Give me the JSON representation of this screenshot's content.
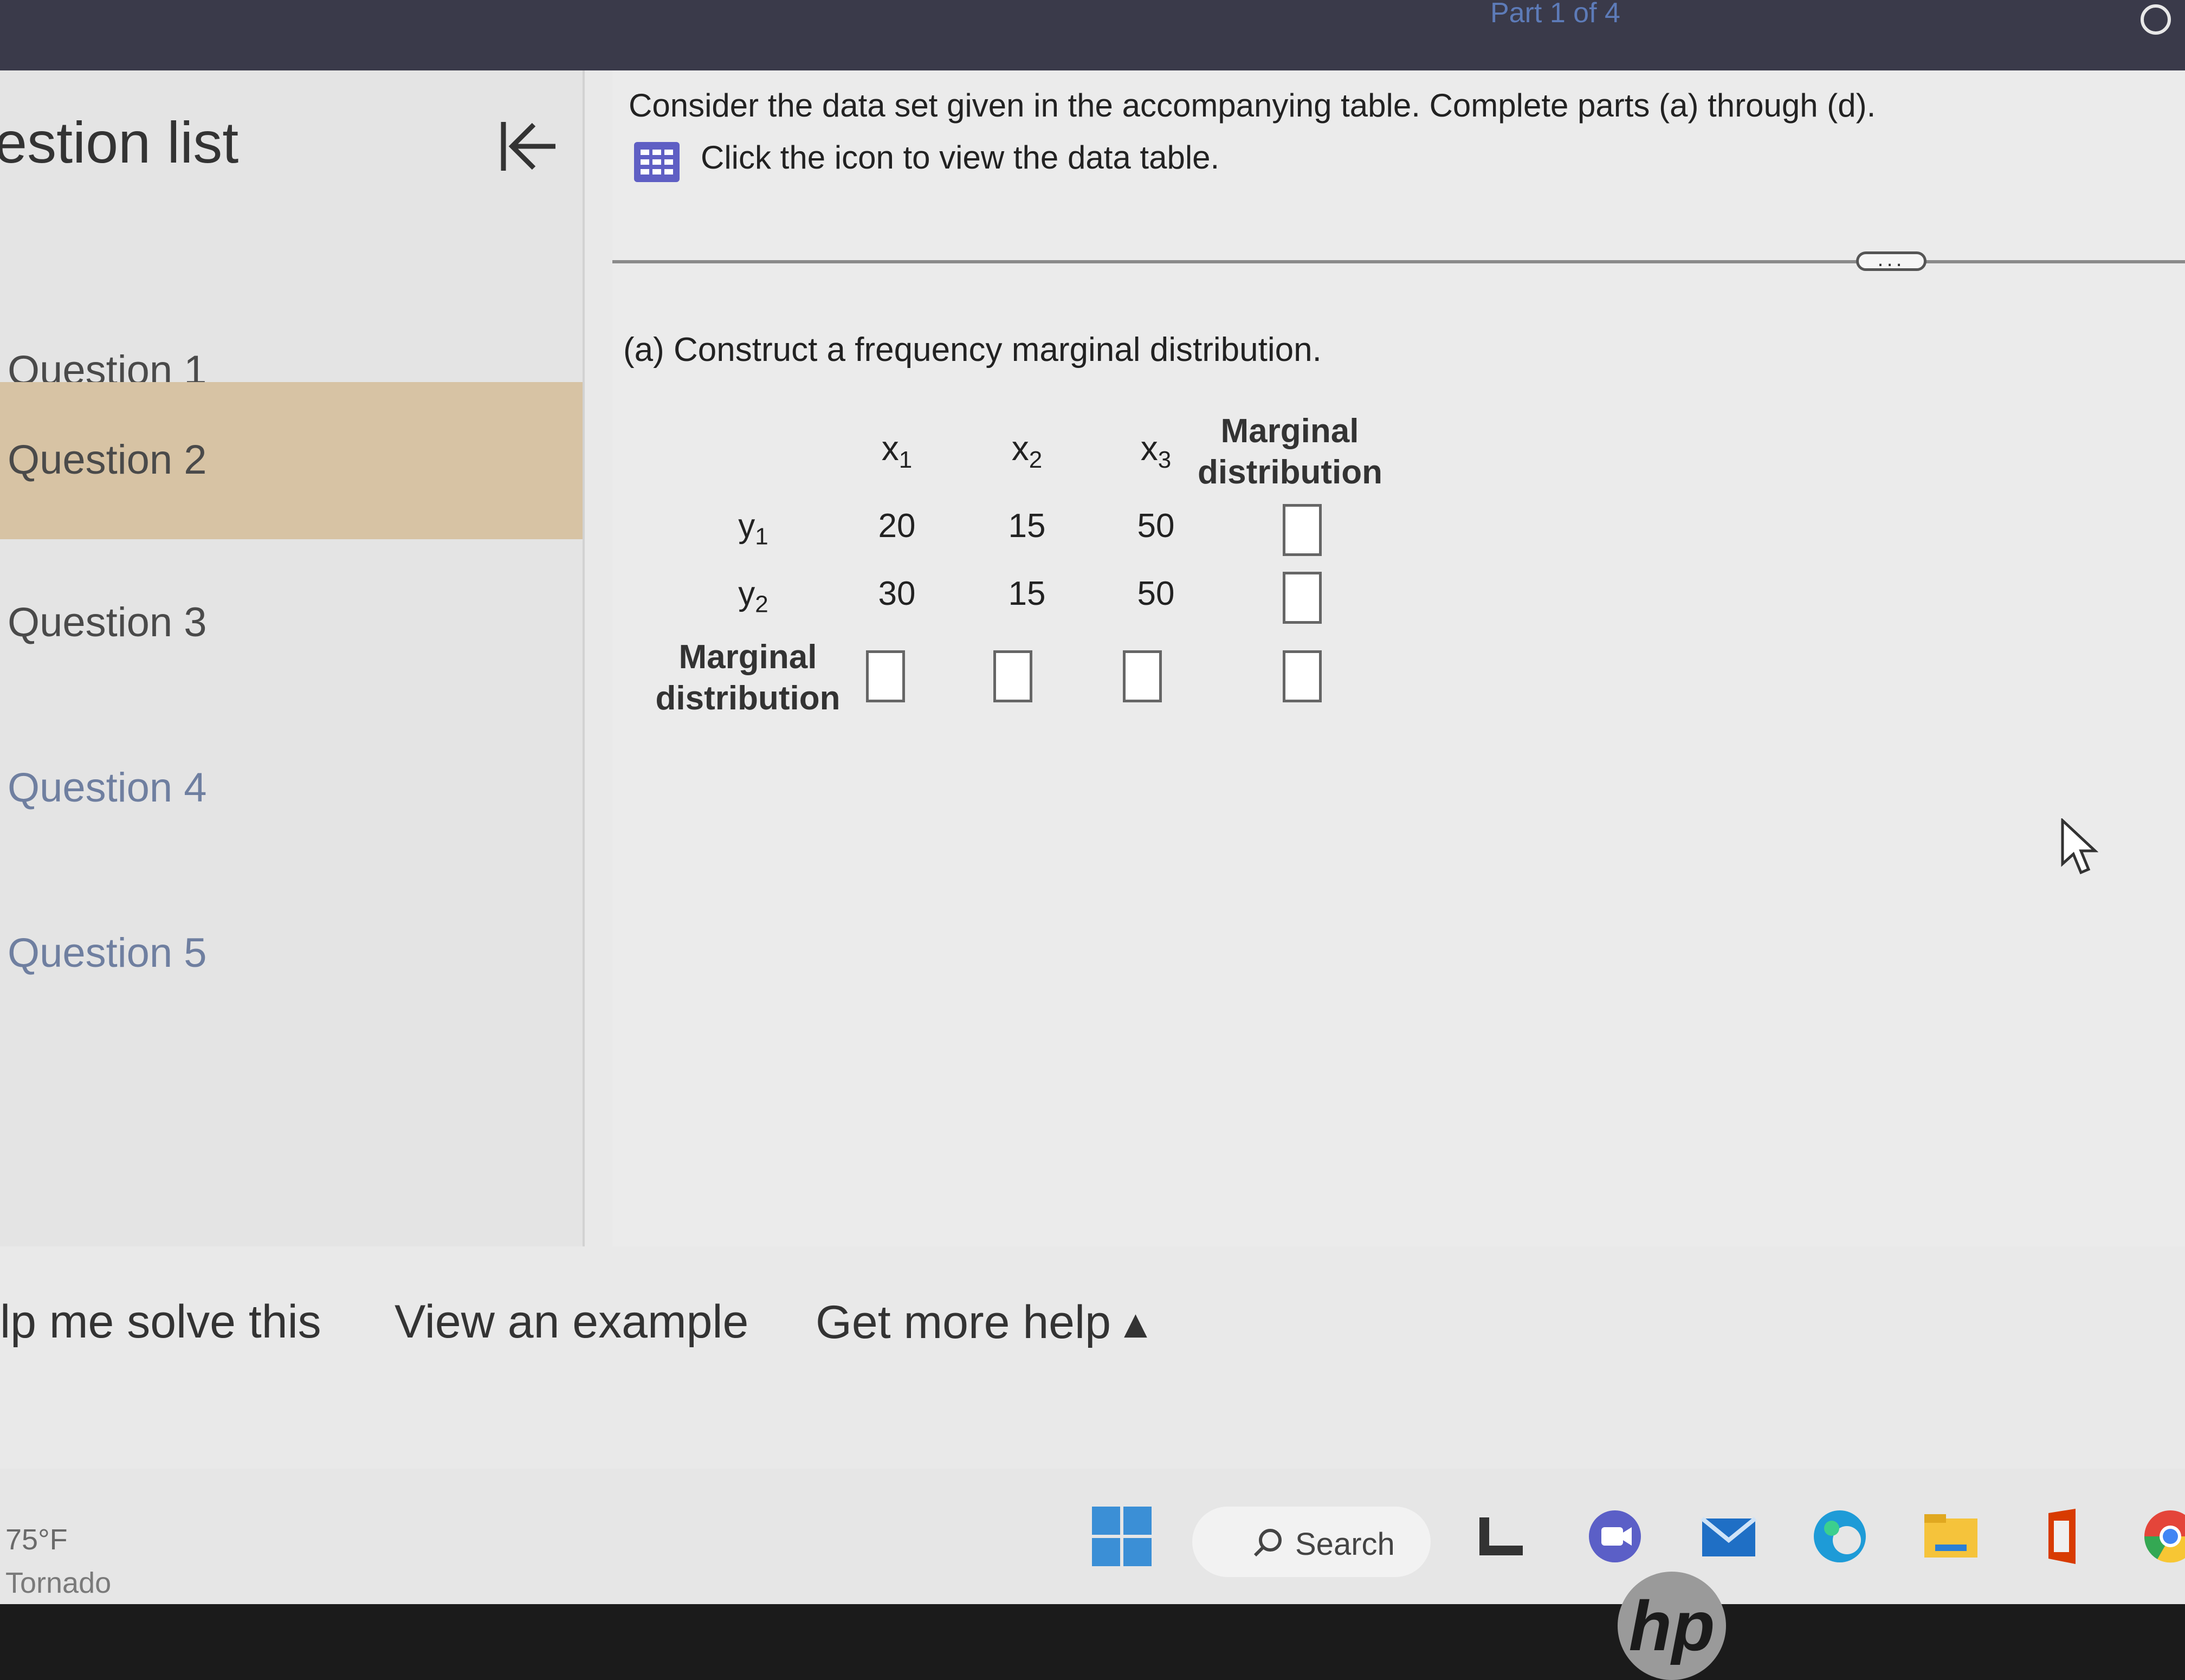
{
  "header": {
    "part_label": "Part 1 of 4"
  },
  "sidebar": {
    "title": "estion list",
    "collapse_icon": "collapse-left-icon",
    "items": [
      {
        "label": "Question 1"
      },
      {
        "label": "Question 2",
        "active": true
      },
      {
        "label": "Question 3"
      },
      {
        "label": "Question 4"
      },
      {
        "label": "Question 5"
      }
    ]
  },
  "question": {
    "prompt": "Consider the data set given in the accompanying table. Complete parts (a) through (d).",
    "icon_link": "Click the icon to view the data table.",
    "more_button": "...",
    "part_heading": "(a) Construct a frequency marginal distribution."
  },
  "table": {
    "col_headers": [
      "x",
      "x",
      "x"
    ],
    "col_subscripts": [
      "1",
      "2",
      "3"
    ],
    "marginal_head_line1": "Marginal",
    "marginal_head_line2": "distribution",
    "rows": [
      {
        "label": "y",
        "sub": "1",
        "values": [
          "20",
          "15",
          "50"
        ]
      },
      {
        "label": "y",
        "sub": "2",
        "values": [
          "30",
          "15",
          "50"
        ]
      }
    ],
    "marginal_row_line1": "Marginal",
    "marginal_row_line2": "distribution"
  },
  "help": {
    "solve": "lp me solve this",
    "example": "View an example",
    "more": "Get more help ▴"
  },
  "taskbar": {
    "temp": "75°F",
    "condition": "Tornado",
    "search": "Search"
  },
  "bezel": {
    "logo": "hp"
  },
  "colors": {
    "active_item": "#d7c3a4",
    "icon_blue": "#5f5fc4"
  }
}
